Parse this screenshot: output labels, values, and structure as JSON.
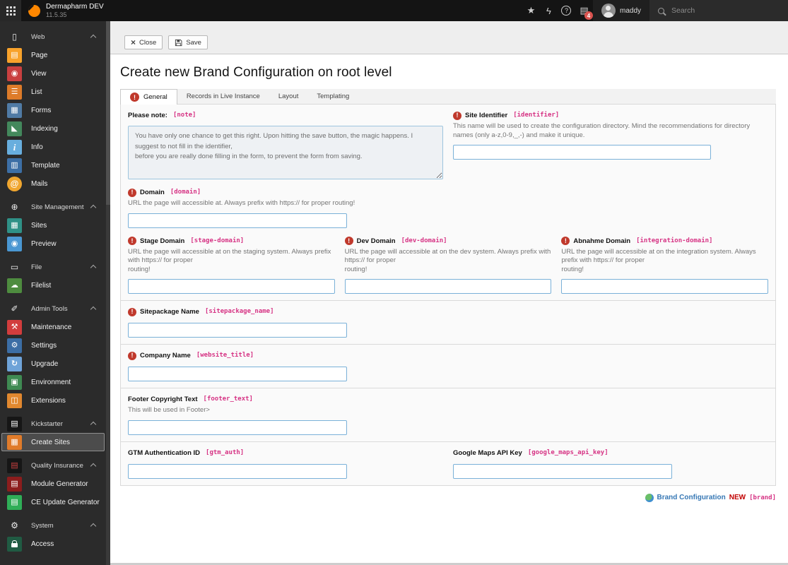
{
  "colors": {
    "topbar_bg": "#141414",
    "sidebar_bg": "#2b2b2b",
    "brand_orange": "#ff8700",
    "required_red": "#c0392c",
    "field_tag_pink": "#d63384",
    "input_border_blue": "#7ab1d8",
    "link_blue": "#3778b5",
    "new_badge_red": "#c20000",
    "notification_red": "#d9534f"
  },
  "topbar": {
    "site_name": "Dermapharm DEV",
    "version": "11.5.35",
    "username": "maddy",
    "notification_count": "4",
    "search_placeholder": "Search",
    "icons": {
      "star": "★",
      "bolt": "ϟ",
      "help": "?",
      "docs": "▤"
    }
  },
  "sidebar": {
    "sections": [
      {
        "label": "Web",
        "icon": "document-outline",
        "glyph": "▯",
        "items": [
          {
            "label": "Page",
            "icon": "page-module",
            "glyph": "▤",
            "bg": "#f8a22b"
          },
          {
            "label": "View",
            "icon": "view-module",
            "glyph": "◉",
            "bg": "#c94040"
          },
          {
            "label": "List",
            "icon": "list-module",
            "glyph": "☰",
            "bg": "#dd7b29"
          },
          {
            "label": "Forms",
            "icon": "forms-module",
            "glyph": "▦",
            "bg": "#507ba5"
          },
          {
            "label": "Indexing",
            "icon": "indexing-module",
            "glyph": "◣",
            "bg": "#43885c"
          },
          {
            "label": "Info",
            "icon": "info-module",
            "glyph": "i",
            "bg": "#68aede"
          },
          {
            "label": "Template",
            "icon": "template-module",
            "glyph": "▥",
            "bg": "#3d6fa5"
          },
          {
            "label": "Mails",
            "icon": "mails-module",
            "glyph": "@",
            "bg": "#f0a62f"
          }
        ]
      },
      {
        "label": "Site Management",
        "icon": "globe-outline",
        "glyph": "⊕",
        "items": [
          {
            "label": "Sites",
            "icon": "sites-module",
            "glyph": "▦",
            "bg": "#2f9187"
          },
          {
            "label": "Preview",
            "icon": "preview-module",
            "glyph": "◉",
            "bg": "#4a97d2"
          }
        ]
      },
      {
        "label": "File",
        "icon": "image-outline",
        "glyph": "▭",
        "items": [
          {
            "label": "Filelist",
            "icon": "filelist-module",
            "glyph": "☁",
            "bg": "#4e8c3f"
          }
        ]
      },
      {
        "label": "Admin Tools",
        "icon": "rocket-outline",
        "glyph": "✐",
        "items": [
          {
            "label": "Maintenance",
            "icon": "maintenance-module",
            "glyph": "⚒",
            "bg": "#d23d3d"
          },
          {
            "label": "Settings",
            "icon": "settings-module",
            "glyph": "⚙",
            "bg": "#3c6ea5"
          },
          {
            "label": "Upgrade",
            "icon": "upgrade-module",
            "glyph": "↻",
            "bg": "#6fa3d8"
          },
          {
            "label": "Environment",
            "icon": "environment-module",
            "glyph": "▣",
            "bg": "#3f8a52"
          },
          {
            "label": "Extensions",
            "icon": "extensions-module",
            "glyph": "◫",
            "bg": "#e1882f"
          }
        ]
      },
      {
        "label": "Kickstarter",
        "icon": "kickstarter-module",
        "glyph": "▤",
        "tile_bg": "#161616",
        "items": [
          {
            "label": "Create Sites",
            "icon": "create-sites-module",
            "glyph": "▦",
            "bg": "#e07b2a",
            "active": true
          }
        ]
      },
      {
        "label": "Quality Insurance",
        "icon": "quality-insurance-module",
        "glyph": "▤",
        "tile_bg": "#161616",
        "glyph_color": "#c94040",
        "items": [
          {
            "label": "Module Generator",
            "icon": "module-generator-module",
            "glyph": "▤",
            "bg": "#8c1d1d"
          },
          {
            "label": "CE Update Generator",
            "icon": "ce-update-generator-module",
            "glyph": "▤",
            "bg": "#2fae57"
          }
        ]
      },
      {
        "label": "System",
        "icon": "gear-outline",
        "glyph": "⚙",
        "items": [
          {
            "label": "Access",
            "icon": "access-module",
            "glyph": "",
            "bg": "#205b43"
          }
        ]
      }
    ]
  },
  "toolbar": {
    "close_label": "Close",
    "save_label": "Save",
    "close_icon": "×"
  },
  "page": {
    "title": "Create new Brand Configuration on root level"
  },
  "tabs": {
    "items": [
      {
        "label": "General",
        "active": true,
        "has_error": true
      },
      {
        "label": "Records in Live Instance"
      },
      {
        "label": "Layout"
      },
      {
        "label": "Templating"
      }
    ]
  },
  "form": {
    "note": {
      "label": "Please note:",
      "tag": "[note]",
      "required": false,
      "value": "You have only one chance to get this right. Upon hitting the save button, the magic happens. I suggest to not fill in the identifier,\nbefore you are really done filling in the form, to prevent the form from saving."
    },
    "identifier": {
      "label": "Site Identifier",
      "tag": "[identifier]",
      "required": true,
      "description": "This name will be used to create the configuration directory. Mind the recommendations for directory names (only a-z,0-9,_,-) and make it unique."
    },
    "domain": {
      "label": "Domain",
      "tag": "[domain]",
      "required": true,
      "description": "URL the page will accessible at. Always prefix with https:// for proper routing!"
    },
    "stage_domain": {
      "label": "Stage Domain",
      "tag": "[stage-domain]",
      "required": true,
      "description": "URL the page will accessible at on the staging system. Always prefix with https:// for proper\nrouting!"
    },
    "dev_domain": {
      "label": "Dev Domain",
      "tag": "[dev-domain]",
      "required": true,
      "description": "URL the page will accessible at on the dev system. Always prefix with https:// for proper\nrouting!"
    },
    "integration_domain": {
      "label": "Abnahme Domain",
      "tag": "[integration-domain]",
      "required": true,
      "description": "URL the page will accessible at on the integration system. Always prefix with https:// for proper\nrouting!"
    },
    "sitepackage_name": {
      "label": "Sitepackage Name",
      "tag": "[sitepackage_name]",
      "required": true
    },
    "website_title": {
      "label": "Company Name",
      "tag": "[website_title]",
      "required": true
    },
    "footer_text": {
      "label": "Footer Copyright Text",
      "tag": "[footer_text]",
      "required": false,
      "description": "This will be used in Footer>"
    },
    "gtm_auth": {
      "label": "GTM Authentication ID",
      "tag": "[gtm_auth]",
      "required": false
    },
    "google_maps_api_key": {
      "label": "Google Maps API Key",
      "tag": "[google_maps_api_key]",
      "required": false
    }
  },
  "footer_record": {
    "type_label": "Brand Configuration",
    "state": "NEW",
    "tag": "[brand]"
  }
}
